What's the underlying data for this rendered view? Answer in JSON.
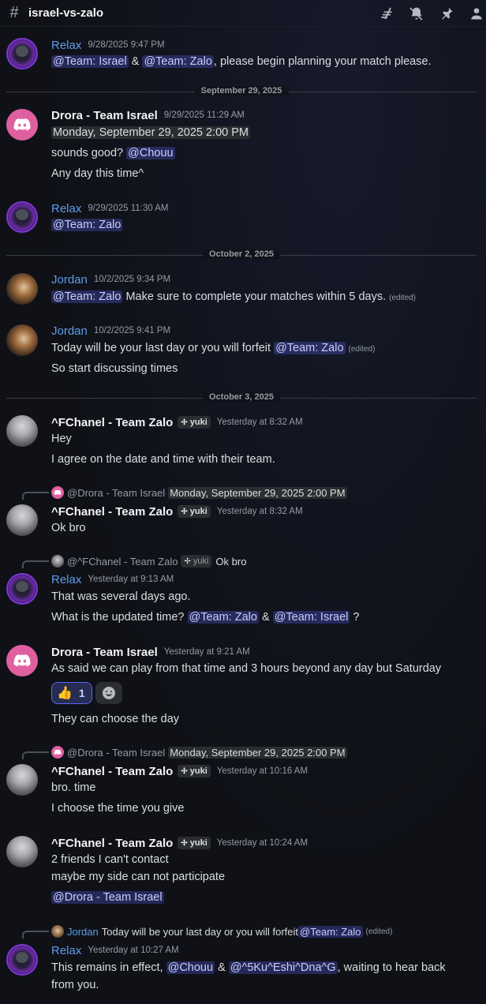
{
  "header": {
    "channel_name": "israel-vs-zalo",
    "icons": [
      "threads-icon",
      "notification-muted-icon",
      "pin-icon",
      "member-list-icon"
    ]
  },
  "dividers": [
    "September 29, 2025",
    "October 2, 2025",
    "October 3, 2025"
  ],
  "tags": {
    "yuki": "yuki"
  },
  "messages": {
    "m1": {
      "author": "Relax",
      "time": "9/28/2025 9:47 PM",
      "mention1": "@Team: Israel",
      "amp": " & ",
      "mention2": "@Team: Zalo",
      "text": ", please begin planning your match please."
    },
    "m2": {
      "author": "Drora - Team Israel",
      "time": "9/29/2025 11:29 AM",
      "timestamp": "Monday, September 29, 2025 2:00 PM",
      "text2": "sounds good? ",
      "mention": "@Chouu",
      "text3": "Any day this time^"
    },
    "m3": {
      "author": "Relax",
      "time": "9/29/2025 11:30 AM",
      "mention": "@Team: Zalo"
    },
    "m4": {
      "author": "Jordan",
      "time": "10/2/2025 9:34 PM",
      "mention": "@Team: Zalo",
      "text": " Make sure to complete your matches within 5 days.",
      "edited": "(edited)"
    },
    "m5": {
      "author": "Jordan",
      "time": "10/2/2025 9:41 PM",
      "text": "Today will be your last day or you will forfeit ",
      "mention": "@Team: Zalo",
      "edited": "(edited)",
      "text2": "So start discussing times"
    },
    "m6": {
      "author": "^FChanel - Team Zalo",
      "time": "Yesterday at 8:32 AM",
      "text": "Hey",
      "text2": "I agree on the date and time with their team."
    },
    "m7": {
      "reply_name": "@Drora - Team Israel",
      "reply_timestamp": "Monday, September 29, 2025 2:00 PM",
      "author": "^FChanel - Team Zalo",
      "time": "Yesterday at 8:32 AM",
      "text": "Ok bro"
    },
    "m8": {
      "reply_name": "@^FChanel - Team Zalo",
      "reply_tag": "yuki",
      "reply_text": "Ok bro",
      "author": "Relax",
      "time": "Yesterday at 9:13 AM",
      "text": "That was several days ago.",
      "text2": "What is the updated time? ",
      "mention1": "@Team: Zalo",
      "amp": " & ",
      "mention2": "@Team: Israel",
      "end": " ?"
    },
    "m9": {
      "author": "Drora - Team Israel",
      "time": "Yesterday at 9:21 AM",
      "text": "As said we can play from that time and 3 hours beyond any day but Saturday",
      "reaction_emoji": "👍",
      "reaction_count": "1",
      "text2": "They can choose the day"
    },
    "m10": {
      "reply_name": "@Drora - Team Israel",
      "reply_timestamp": "Monday, September 29, 2025 2:00 PM",
      "author": "^FChanel - Team Zalo",
      "time": "Yesterday at 10:16 AM",
      "text": "bro. time",
      "text2": "I choose the time you give"
    },
    "m11": {
      "author": "^FChanel - Team Zalo",
      "time": "Yesterday at 10:24 AM",
      "text": "2 friends I can't contact",
      "text2": "maybe my side can not participate",
      "mention": "@Drora - Team Israel"
    },
    "m12": {
      "reply_name": "Jordan",
      "reply_text": "Today will be your last day or you will forfeit ",
      "reply_mention": "@Team: Zalo",
      "reply_edited": "(edited)",
      "author": "Relax",
      "time": "Yesterday at 10:27 AM",
      "text": "This remains in effect, ",
      "mention1": "@Chouu",
      "amp": " & ",
      "mention2": "@^5Ku^Eshi^Dna^G",
      "text_end": ", waiting to hear back",
      "text2": "from you."
    }
  }
}
